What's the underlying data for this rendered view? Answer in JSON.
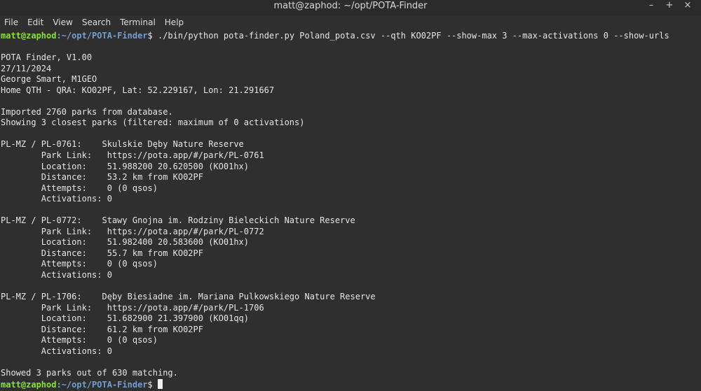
{
  "window": {
    "title": "matt@zaphod: ~/opt/POTA-Finder",
    "controls": [
      "–",
      "+",
      "×"
    ]
  },
  "menubar": {
    "items": [
      "File",
      "Edit",
      "View",
      "Search",
      "Terminal",
      "Help"
    ]
  },
  "prompt": {
    "user_host": "matt@zaphod",
    "path": ":~/opt/POTA-Finder",
    "symbol": "$ "
  },
  "command": "./bin/python pota-finder.py Poland_pota.csv --qth KO02PF --show-max 3 --max-activations 0 --show-urls",
  "output": [
    "",
    "POTA Finder, V1.00",
    "27/11/2024",
    "George Smart, M1GEO",
    "Home QTH - QRA: KO02PF, Lat: 52.229167, Lon: 21.291667",
    "",
    "Imported 2760 parks from database.",
    "Showing 3 closest parks (filtered: maximum of 0 activations)",
    "",
    "PL-MZ / PL-0761:    Skulskie Dęby Nature Reserve",
    "        Park Link:   https://pota.app/#/park/PL-0761",
    "        Location:    51.988200 20.620500 (KO01hx)",
    "        Distance:    53.2 km from KO02PF",
    "        Attempts:    0 (0 qsos)",
    "        Activations: 0",
    "",
    "PL-MZ / PL-0772:    Stawy Gnojna im. Rodziny Bieleckich Nature Reserve",
    "        Park Link:   https://pota.app/#/park/PL-0772",
    "        Location:    51.982400 20.583600 (KO01hx)",
    "        Distance:    55.7 km from KO02PF",
    "        Attempts:    0 (0 qsos)",
    "        Activations: 0",
    "",
    "PL-MZ / PL-1706:    Dęby Biesiadne im. Mariana Pulkowskiego Nature Reserve",
    "        Park Link:   https://pota.app/#/park/PL-1706",
    "        Location:    51.682900 21.397900 (KO01qq)",
    "        Distance:    61.2 km from KO02PF",
    "        Attempts:    0 (0 qsos)",
    "        Activations: 0",
    "",
    "Showed 3 parks out of 630 matching."
  ],
  "colors": {
    "background": "#2f2f2f",
    "text": "#e5e5e5",
    "prompt_user": "#8ae234",
    "prompt_path": "#729fcf"
  }
}
